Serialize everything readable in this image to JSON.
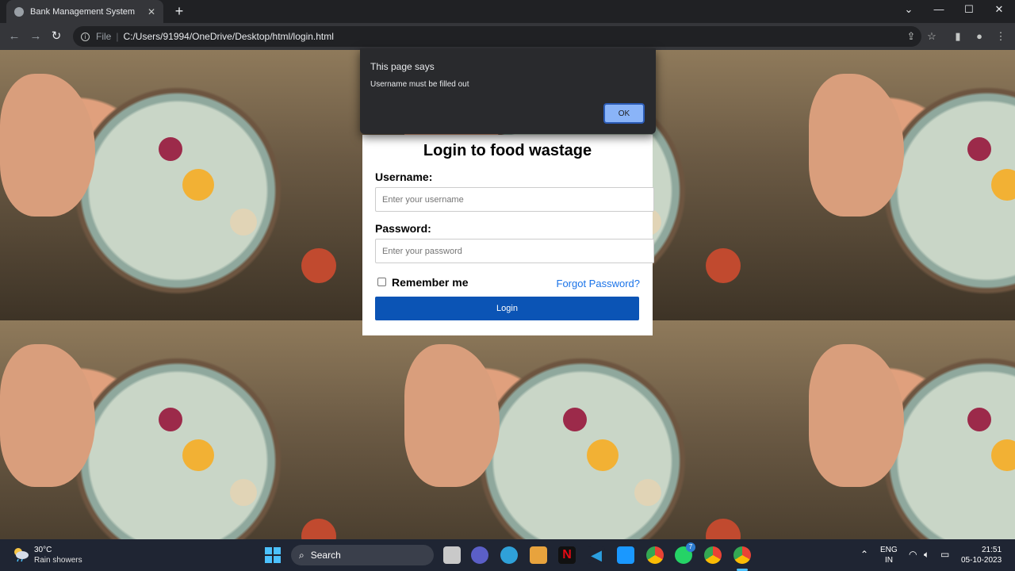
{
  "browser": {
    "tab_title": "Bank Management System",
    "new_tab_symbol": "+",
    "omnibox_scheme": "File",
    "url": "C:/Users/91994/OneDrive/Desktop/html/login.html"
  },
  "login": {
    "title": "Login to food wastage",
    "username_label": "Username:",
    "username_placeholder": "Enter your username",
    "password_label": "Password:",
    "password_placeholder": "Enter your password",
    "remember_label": "Remember me",
    "forgot_label": "Forgot Password?",
    "login_button": "Login"
  },
  "alert": {
    "title": "This page says",
    "message": "Username must be filled out",
    "ok_label": "OK"
  },
  "taskbar": {
    "weather_temp": "30°C",
    "weather_desc": "Rain showers",
    "search_label": "Search",
    "whatsapp_badge": "7",
    "language": "ENG",
    "region": "IN",
    "time": "21:51",
    "date": "05-10-2023"
  },
  "colors": {
    "login_button": "#0b54b5",
    "link": "#1a73e8",
    "alert_ok": "#8ab4f8"
  }
}
